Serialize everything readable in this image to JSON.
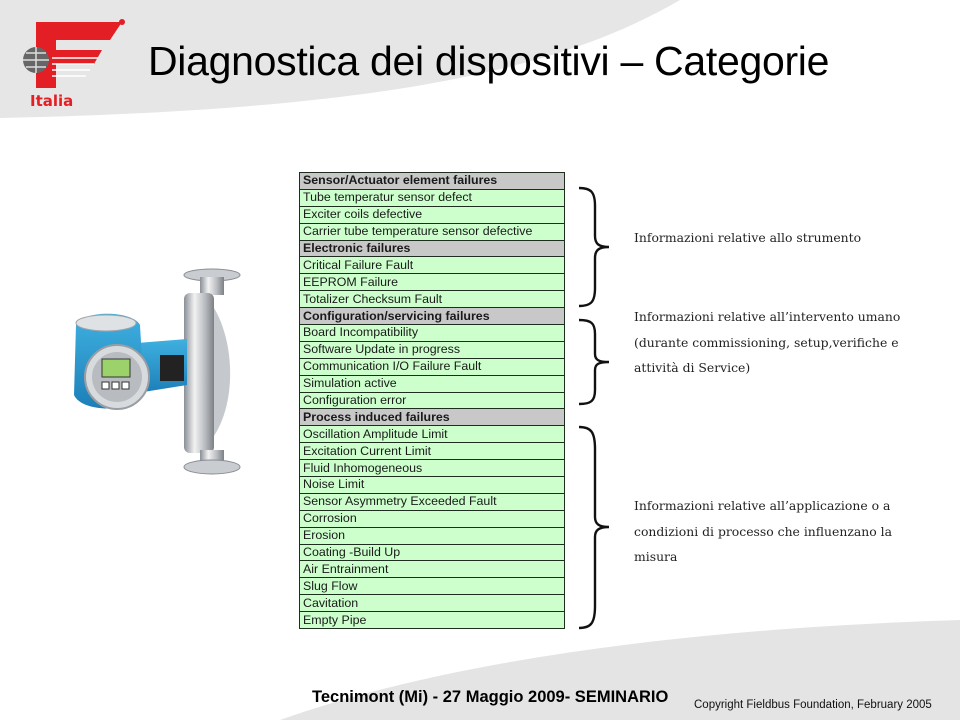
{
  "header": {
    "title": "Diagnostica dei dispositivi – Categorie",
    "logo_text": "Italia",
    "brand_color": "#e31e24"
  },
  "table": {
    "rows": [
      {
        "type": "category",
        "label": "Sensor/Actuator element failures"
      },
      {
        "type": "item",
        "label": "Tube temperatur sensor defect"
      },
      {
        "type": "item",
        "label": "Exciter coils defective"
      },
      {
        "type": "item",
        "label": "Carrier tube temperature sensor defective"
      },
      {
        "type": "category",
        "label": "Electronic failures"
      },
      {
        "type": "item",
        "label": "Critical Failure Fault"
      },
      {
        "type": "item",
        "label": "EEPROM Failure"
      },
      {
        "type": "item",
        "label": "Totalizer Checksum Fault"
      },
      {
        "type": "category",
        "label": "Configuration/servicing failures"
      },
      {
        "type": "item",
        "label": "Board Incompatibility"
      },
      {
        "type": "item",
        "label": "Software Update in progress"
      },
      {
        "type": "item",
        "label": "Communication I/O Failure Fault"
      },
      {
        "type": "item",
        "label": "Simulation active"
      },
      {
        "type": "item",
        "label": "Configuration error"
      },
      {
        "type": "category",
        "label": "Process induced failures"
      },
      {
        "type": "item",
        "label": "Oscillation Amplitude Limit"
      },
      {
        "type": "item",
        "label": "Excitation Current Limit"
      },
      {
        "type": "item",
        "label": "Fluid Inhomogeneous"
      },
      {
        "type": "item",
        "label": "Noise Limit"
      },
      {
        "type": "item",
        "label": "Sensor Asymmetry Exceeded Fault"
      },
      {
        "type": "item",
        "label": "Corrosion"
      },
      {
        "type": "item",
        "label": "Erosion"
      },
      {
        "type": "item",
        "label": "Coating -Build Up"
      },
      {
        "type": "item",
        "label": "Air Entrainment"
      },
      {
        "type": "item",
        "label": "Slug Flow"
      },
      {
        "type": "item",
        "label": "Cavitation"
      },
      {
        "type": "item",
        "label": "Empty Pipe"
      }
    ],
    "category_color": "#c8c8c8",
    "item_color": "#ccffcc"
  },
  "descriptions": [
    {
      "lines": [
        "Informazioni relative allo strumento"
      ]
    },
    {
      "lines": [
        "Informazioni relative all’intervento umano",
        "(durante commissioning, setup,verifiche e",
        "attività di Service)"
      ]
    },
    {
      "lines": [
        "Informazioni relative all’applicazione o a",
        "condizioni di processo che influenzano la",
        "misura"
      ]
    }
  ],
  "footer": {
    "event": "Tecnimont  (Mi) - 27 Maggio 2009- SEMINARIO",
    "copyright": "Copyright Fieldbus Foundation, February 2005"
  }
}
